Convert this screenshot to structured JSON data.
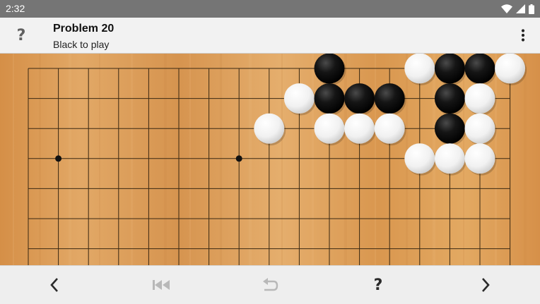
{
  "status": {
    "time": "2:32"
  },
  "header": {
    "title": "Problem 20",
    "subtitle": "Black to play",
    "help_label": "?"
  },
  "bottom": {
    "hint_label": "?"
  },
  "board": {
    "visible_cols": 17,
    "visible_rows": 7,
    "star_points": [
      [
        1,
        3
      ],
      [
        7,
        3
      ]
    ],
    "stones": [
      {
        "color": "black",
        "col": 10,
        "row": 0
      },
      {
        "color": "white",
        "col": 13,
        "row": 0
      },
      {
        "color": "black",
        "col": 14,
        "row": 0
      },
      {
        "color": "black",
        "col": 15,
        "row": 0
      },
      {
        "color": "white",
        "col": 16,
        "row": 0
      },
      {
        "color": "white",
        "col": 9,
        "row": 1
      },
      {
        "color": "black",
        "col": 10,
        "row": 1
      },
      {
        "color": "black",
        "col": 11,
        "row": 1
      },
      {
        "color": "black",
        "col": 12,
        "row": 1
      },
      {
        "color": "black",
        "col": 14,
        "row": 1
      },
      {
        "color": "white",
        "col": 15,
        "row": 1
      },
      {
        "color": "white",
        "col": 8,
        "row": 2
      },
      {
        "color": "white",
        "col": 10,
        "row": 2
      },
      {
        "color": "white",
        "col": 11,
        "row": 2
      },
      {
        "color": "white",
        "col": 12,
        "row": 2
      },
      {
        "color": "black",
        "col": 14,
        "row": 2
      },
      {
        "color": "white",
        "col": 15,
        "row": 2
      },
      {
        "color": "white",
        "col": 13,
        "row": 3
      },
      {
        "color": "white",
        "col": 14,
        "row": 3
      },
      {
        "color": "white",
        "col": 15,
        "row": 3
      }
    ]
  },
  "colors": {
    "status_bar": "#757575",
    "app_bar": "#f2f2f2",
    "board_wood": "#dc9a55",
    "grid_line": "#3a2812",
    "black_stone": "#111111",
    "white_stone": "#f4f4f4",
    "icon_enabled": "#2a2a2a",
    "icon_disabled": "#b8b8b8"
  }
}
